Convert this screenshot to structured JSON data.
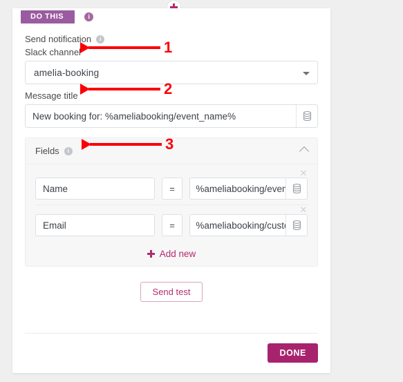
{
  "connector": {
    "add_icon": "plus-icon",
    "arrow_icon": "arrow-down-icon"
  },
  "card": {
    "header": {
      "tag_label": "DO THIS",
      "info_icon": "info-icon"
    },
    "send_notification": {
      "label": "Send notification",
      "info_icon": "info-icon"
    },
    "slack_channel": {
      "label": "Slack channel",
      "value": "amelia-booking",
      "caret_icon": "chevron-down-icon"
    },
    "message_title": {
      "label": "Message title",
      "value": "New booking for: %ameliabooking/event_name%",
      "db_icon": "database-icon"
    },
    "fields": {
      "title": "Fields",
      "info_icon": "info-icon",
      "collapse_icon": "chevron-up-icon",
      "remove_icon": "close-icon",
      "db_icon": "database-icon",
      "operator": "=",
      "rows": [
        {
          "key": "Name",
          "value": "%ameliabooking/event_nam"
        },
        {
          "key": "Email",
          "value": "%ameliabooking/customer_"
        }
      ],
      "add_new_label": "Add new",
      "add_icon": "plus-icon"
    },
    "send_test_label": "Send test",
    "done_label": "DONE"
  },
  "annotations": {
    "items": [
      {
        "number": "1"
      },
      {
        "number": "2"
      },
      {
        "number": "3"
      }
    ],
    "color": "#fb0007"
  }
}
